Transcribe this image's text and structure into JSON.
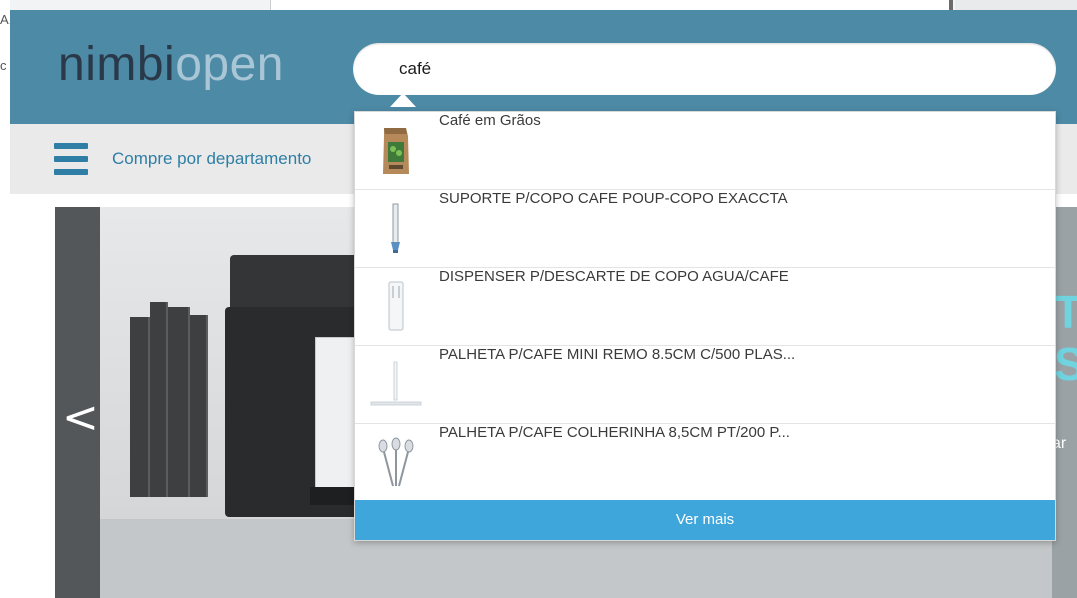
{
  "header": {
    "logo_dark": "nimbi",
    "logo_light": "open"
  },
  "search": {
    "value": "café",
    "placeholder": ""
  },
  "nav": {
    "department_label": "Compre por departamento"
  },
  "suggestions": [
    {
      "label": "Café em Grãos",
      "thumb": "coffee-bag-icon"
    },
    {
      "label": "SUPORTE P/COPO CAFE POUP-COPO EXACCTA",
      "thumb": "cup-holder-icon"
    },
    {
      "label": "DISPENSER P/DESCARTE DE COPO AGUA/CAFE",
      "thumb": "cup-dispenser-icon"
    },
    {
      "label": "PALHETA P/CAFE MINI REMO 8.5CM C/500 PLAS...",
      "thumb": "stirrer-icon"
    },
    {
      "label": "PALHETA P/CAFE COLHERINHA 8,5CM PT/200 P...",
      "thumb": "spoons-icon"
    }
  ],
  "see_more_label": "Ver mais",
  "background_fragments": {
    "left_1": "A,",
    "left_2": "c"
  },
  "banner": {
    "prev_label": "<",
    "right_line_1": "T",
    "right_line_2": "S",
    "right_line_3": "ar"
  },
  "colors": {
    "header_bg": "#4d8aa6",
    "accent": "#2e7ea5",
    "see_more_bg": "#3fa6dc"
  }
}
